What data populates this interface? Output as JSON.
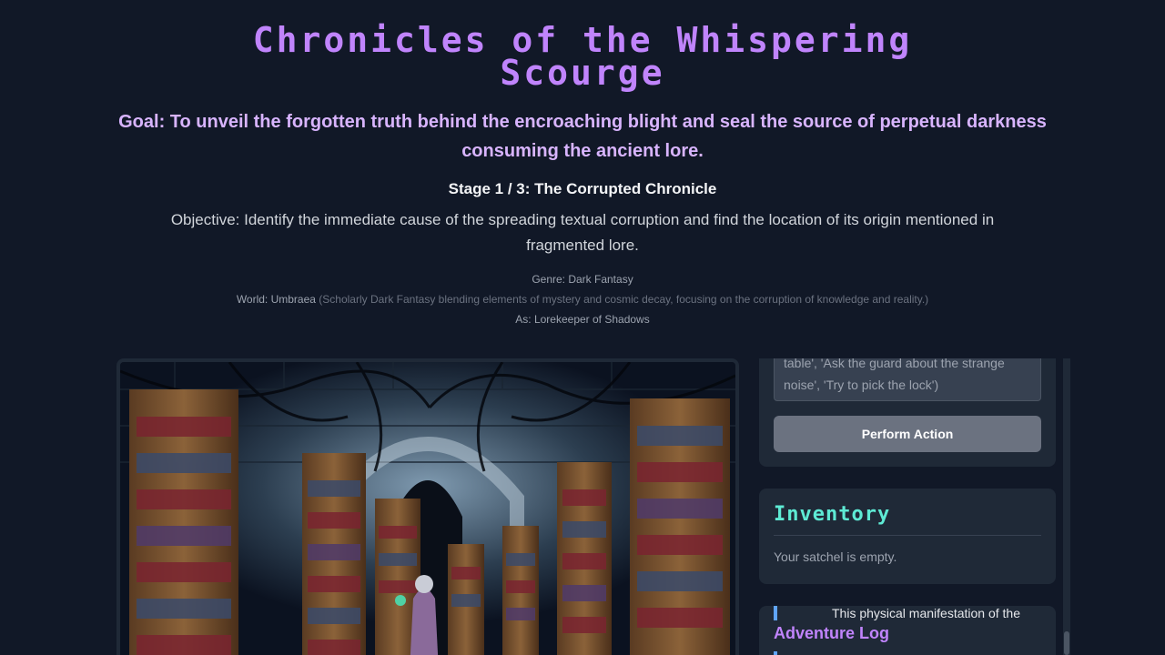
{
  "game": {
    "title": "Chronicles of the Whispering Scourge",
    "goal": "Goal: To unveil the forgotten truth behind the encroaching blight and seal the source of perpetual darkness consuming the ancient lore.",
    "stage": "Stage 1 / 3: The Corrupted Chronicle",
    "objective": "Objective: Identify the immediate cause of the spreading textual corruption and find the location of its origin mentioned in fragmented lore.",
    "genre": "Genre: Dark Fantasy",
    "world_label": "World: Umbraea",
    "world_desc": "(Scholarly Dark Fantasy blending elements of mystery and cosmic decay, focusing on the corruption of knowledge and reality.)",
    "role": "As: Lorekeeper of Shadows"
  },
  "action": {
    "placeholder_line1": "table', 'Ask the guard about the strange",
    "placeholder_line2": "noise', 'Try to pick the lock')",
    "button_label": "Perform Action"
  },
  "inventory": {
    "title": "Inventory",
    "empty_text": "Your satchel is empty."
  },
  "log": {
    "title": "Adventure Log",
    "snippet": "This physical manifestation of the"
  },
  "colors": {
    "background": "#111827",
    "title": "#c084fc",
    "goal": "#d8b4fe",
    "inventory_title": "#5eead4",
    "panel": "#1f2937",
    "button": "#6b7280",
    "log_accent": "#60a5fa"
  }
}
